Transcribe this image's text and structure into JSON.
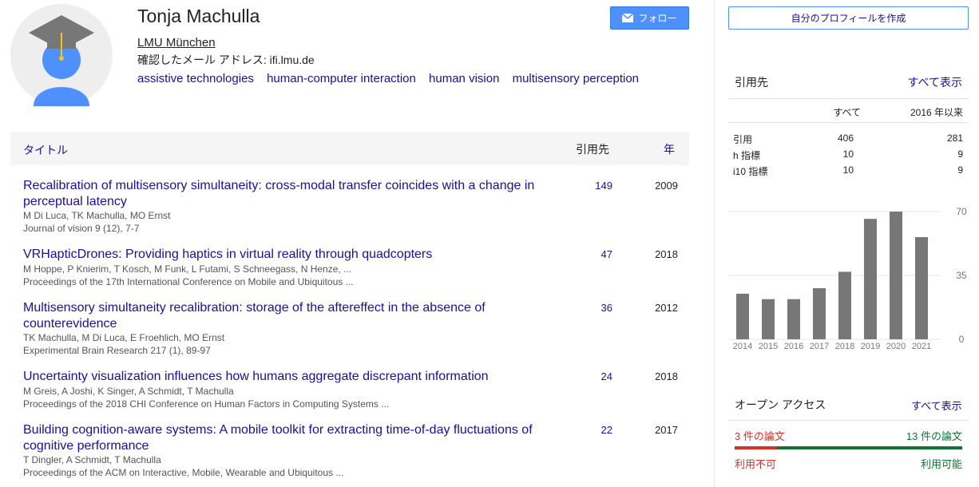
{
  "profile": {
    "name": "Tonja Machulla",
    "affiliation": "LMU München",
    "email_label": "確認したメール アドレス: ifi.lmu.de",
    "interests": [
      "assistive technologies",
      "human-computer interaction",
      "human vision",
      "multisensory perception"
    ],
    "avatar_icon": "graduation-cap-user-icon",
    "follow_label": "フォロー",
    "follow_icon": "envelope-icon",
    "follow_color": "#4d90fe"
  },
  "table": {
    "col_title": "タイトル",
    "col_cited": "引用先",
    "col_year": "年",
    "rows": [
      {
        "title": "Recalibration of multisensory simultaneity: cross-modal transfer coincides with a change in perceptual latency",
        "authors": "M Di Luca, TK Machulla, MO Ernst",
        "venue": "Journal of vision 9 (12), 7-7",
        "cites": "149",
        "year": "2009"
      },
      {
        "title": "VRHapticDrones: Providing haptics in virtual reality through quadcopters",
        "authors": "M Hoppe, P Knierim, T Kosch, M Funk, L Futami, S Schneegass, N Henze, ...",
        "venue": "Proceedings of the 17th International Conference on Mobile and Ubiquitous ...",
        "cites": "47",
        "year": "2018"
      },
      {
        "title": "Multisensory simultaneity recalibration: storage of the aftereffect in the absence of counterevidence",
        "authors": "TK Machulla, M Di Luca, E Froehlich, MO Ernst",
        "venue": "Experimental Brain Research 217 (1), 89-97",
        "cites": "36",
        "year": "2012"
      },
      {
        "title": "Uncertainty visualization influences how humans aggregate discrepant information",
        "authors": "M Greis, A Joshi, K Singer, A Schmidt, T Machulla",
        "venue": "Proceedings of the 2018 CHI Conference on Human Factors in Computing Systems ...",
        "cites": "24",
        "year": "2018"
      },
      {
        "title": "Building cognition-aware systems: A mobile toolkit for extracting time-of-day fluctuations of cognitive performance",
        "authors": "T Dingler, A Schmidt, T Machulla",
        "venue": "Proceedings of the ACM on Interactive, Mobile, Wearable and Ubiquitous ...",
        "cites": "22",
        "year": "2017"
      }
    ]
  },
  "sidebar": {
    "create_profile_label": "自分のプロフィールを作成",
    "cited_by_title": "引用先",
    "show_all_label": "すべて表示",
    "stats": {
      "headers": [
        "",
        "すべて",
        "2016 年以来"
      ],
      "rows": [
        [
          "引用",
          "406",
          "281"
        ],
        [
          "h 指標",
          "10",
          "9"
        ],
        [
          "i10 指標",
          "10",
          "9"
        ]
      ]
    },
    "open_access": {
      "title": "オープン アクセス",
      "show_all_label": "すべて表示",
      "unavailable_count": "3 件の論文",
      "available_count": "13 件の論文",
      "unavailable_label": "利用不可",
      "available_label": "利用可能",
      "unavailable_fraction": 0.1875,
      "unavailable_color": "#d93025",
      "available_color": "#137333"
    }
  },
  "chart_data": {
    "type": "bar",
    "categories": [
      "2014",
      "2015",
      "2016",
      "2017",
      "2018",
      "2019",
      "2020",
      "2021"
    ],
    "values": [
      25,
      22,
      22,
      28,
      37,
      66,
      70,
      56
    ],
    "ylim": [
      0,
      70
    ],
    "yticks": [
      "70",
      "35",
      "0"
    ],
    "bar_color": "#777777",
    "grid": true,
    "title": "",
    "xlabel": "",
    "ylabel": ""
  }
}
